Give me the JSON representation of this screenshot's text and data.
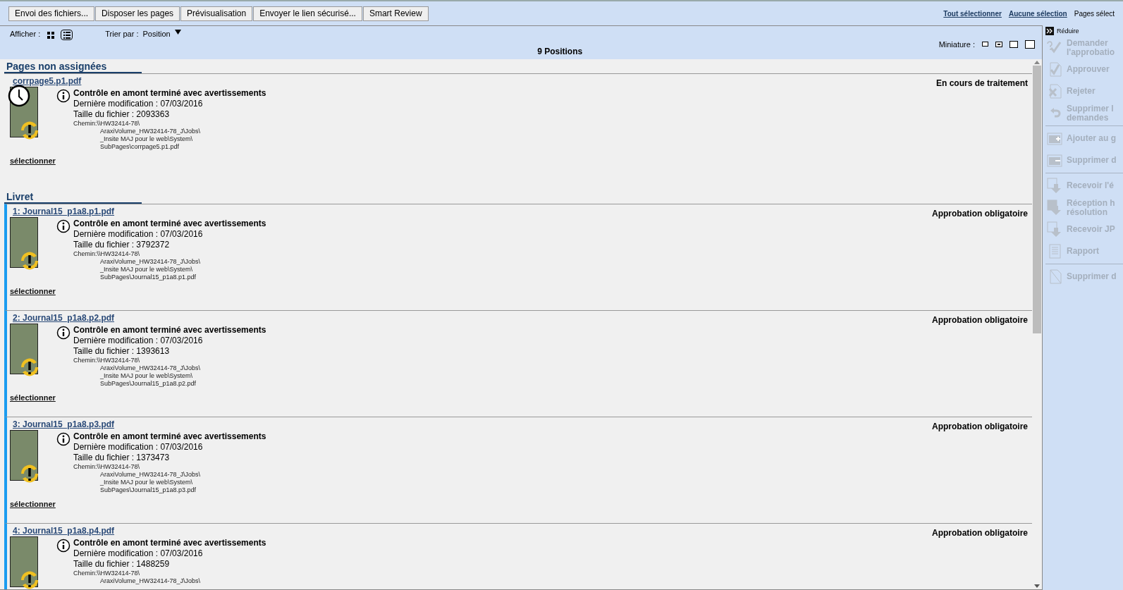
{
  "toolbar": {
    "buttons": [
      "Envoi des fichiers...",
      "Disposer les pages",
      "Prévisualisation",
      "Envoyer le lien sécurisé...",
      "Smart Review"
    ],
    "links": [
      "Tout sélectionner",
      "Aucune sélection"
    ],
    "pages_label": "Pages sélect"
  },
  "view_bar": {
    "show_label": "Afficher :",
    "views": [
      {
        "kind": "grid",
        "selected": false
      },
      {
        "kind": "list",
        "selected": true
      }
    ],
    "sort_label": "Trier par :",
    "sort_value": "Position",
    "thumbnail_label": "Miniature :",
    "thumbnail_sizes": [
      {
        "kind": "tiny",
        "selected": false
      },
      {
        "kind": "small",
        "selected": true
      },
      {
        "kind": "medium",
        "selected": false
      },
      {
        "kind": "large",
        "selected": false
      }
    ],
    "count": "9 Positions"
  },
  "sections": [
    {
      "title": "Pages non assignées",
      "items": [
        {
          "file": "corrpage5.p1.pdf",
          "status": "En cours de traitement",
          "highlighted": false,
          "processing": true,
          "check": "Contrôle en amont terminé avec avertissements",
          "modified": "Dernière modification : 07/03/2016",
          "size": "Taille du fichier : 2093363",
          "path": [
            "Chemin:\\\\HW32414-78\\",
            "AraxiVolume_HW32414-78_J\\Jobs\\",
            "_Insite MAJ pour le web\\System\\",
            "SubPages\\corrpage5.p1.pdf"
          ],
          "select": "sélectionner"
        }
      ]
    },
    {
      "title": "Livret",
      "items": [
        {
          "file": "1: Journal15_p1a8.p1.pdf",
          "status": "Approbation obligatoire",
          "highlighted": true,
          "processing": false,
          "check": "Contrôle en amont terminé avec avertissements",
          "modified": "Dernière modification : 07/03/2016",
          "size": "Taille du fichier : 3792372",
          "path": [
            "Chemin:\\\\HW32414-78\\",
            "AraxiVolume_HW32414-78_J\\Jobs\\",
            "_Insite MAJ pour le web\\System\\",
            "SubPages\\Journal15_p1a8.p1.pdf"
          ],
          "select": "sélectionner"
        },
        {
          "file": "2: Journal15_p1a8.p2.pdf",
          "status": "Approbation obligatoire",
          "highlighted": true,
          "processing": false,
          "check": "Contrôle en amont terminé avec avertissements",
          "modified": "Dernière modification : 07/03/2016",
          "size": "Taille du fichier : 1393613",
          "path": [
            "Chemin:\\\\HW32414-78\\",
            "AraxiVolume_HW32414-78_J\\Jobs\\",
            "_Insite MAJ pour le web\\System\\",
            "SubPages\\Journal15_p1a8.p2.pdf"
          ],
          "select": "sélectionner"
        },
        {
          "file": "3: Journal15_p1a8.p3.pdf",
          "status": "Approbation obligatoire",
          "highlighted": true,
          "processing": false,
          "check": "Contrôle en amont terminé avec avertissements",
          "modified": "Dernière modification : 07/03/2016",
          "size": "Taille du fichier : 1373473",
          "path": [
            "Chemin:\\\\HW32414-78\\",
            "AraxiVolume_HW32414-78_J\\Jobs\\",
            "_Insite MAJ pour le web\\System\\",
            "SubPages\\Journal15_p1a8.p3.pdf"
          ],
          "select": "sélectionner"
        },
        {
          "file": "4: Journal15_p1a8.p4.pdf",
          "status": "Approbation obligatoire",
          "highlighted": true,
          "processing": false,
          "check": "Contrôle en amont terminé avec avertissements",
          "modified": "Dernière modification : 07/03/2016",
          "size": "Taille du fichier : 1488259",
          "path": [
            "Chemin:\\\\HW32414-78\\",
            "AraxiVolume_HW32414-78_J\\Jobs\\"
          ]
        }
      ]
    }
  ],
  "sidebar": {
    "collapse": "Réduire",
    "groups": [
      [
        {
          "kind": "request",
          "label": [
            "Demander",
            "l'approbatio"
          ],
          "disabled": true
        },
        {
          "kind": "approve",
          "label": [
            "Approuver"
          ],
          "disabled": true
        },
        {
          "kind": "reject",
          "label": [
            "Rejeter"
          ],
          "disabled": true
        },
        {
          "kind": "undo",
          "label": [
            "Supprimer l",
            "demandes"
          ],
          "disabled": true
        }
      ],
      [
        {
          "kind": "folder-add",
          "label": [
            "Ajouter au g"
          ],
          "disabled": true
        },
        {
          "kind": "folder-remove",
          "label": [
            "Supprimer d"
          ],
          "disabled": true
        }
      ],
      [
        {
          "kind": "download",
          "label": [
            "Recevoir l'é"
          ],
          "disabled": true
        },
        {
          "kind": "download-hi",
          "label": [
            "Réception h",
            "résolution"
          ],
          "disabled": true
        },
        {
          "kind": "download-jpg",
          "label": [
            "Recevoir JP"
          ],
          "disabled": true
        },
        {
          "kind": "report",
          "label": [
            "Rapport"
          ],
          "disabled": true
        }
      ],
      [
        {
          "kind": "delete",
          "label": [
            "Supprimer d"
          ],
          "disabled": true
        }
      ]
    ]
  }
}
